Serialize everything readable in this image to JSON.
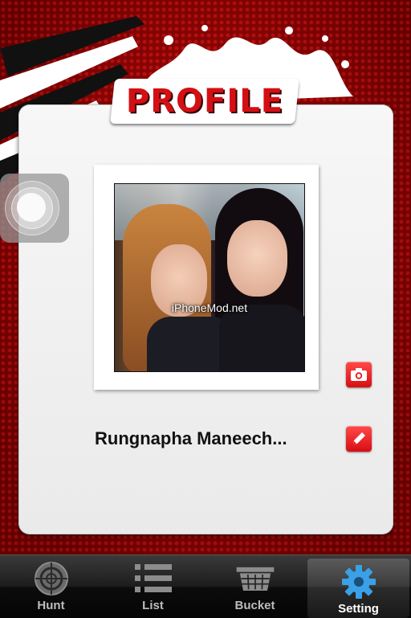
{
  "header": {
    "title": "PROFILE"
  },
  "profile": {
    "name": "Rungnapha Maneech...",
    "photo_watermark": "iPhoneMod.net"
  },
  "icons": {
    "camera": "camera-icon",
    "edit": "pencil-icon",
    "assistive_touch": "assistive-touch-icon"
  },
  "tabs": [
    {
      "label": "Hunt",
      "icon": "crosshair-icon",
      "active": false
    },
    {
      "label": "List",
      "icon": "list-icon",
      "active": false
    },
    {
      "label": "Bucket",
      "icon": "basket-icon",
      "active": false
    },
    {
      "label": "Setting",
      "icon": "gear-icon",
      "active": true
    }
  ],
  "colors": {
    "accent": "#d40f14",
    "background": "#9a0000",
    "active_tab_icon": "#3aa0e8"
  }
}
